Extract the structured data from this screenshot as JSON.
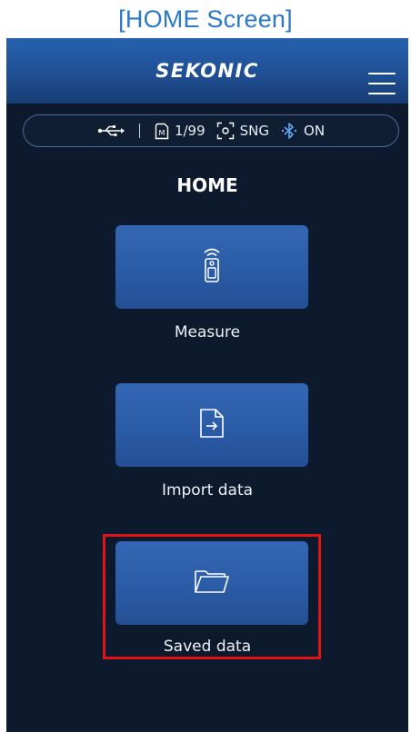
{
  "caption": "[HOME Screen]",
  "header": {
    "brand": "SEKONIC",
    "menu_icon": "hamburger-menu-icon"
  },
  "status_bar": {
    "usb_icon": "usb-icon",
    "memory_icon": "memory-card-icon",
    "memory_count": "1/99",
    "mode_icon": "single-mode-icon",
    "mode": "SNG",
    "bluetooth_icon": "bluetooth-icon",
    "bluetooth_state": "ON"
  },
  "page_title": "HOME",
  "tiles": [
    {
      "label": "Measure",
      "icon": "light-meter-device-icon"
    },
    {
      "label": "Import data",
      "icon": "import-file-icon"
    },
    {
      "label": "Saved data",
      "icon": "folder-icon",
      "highlighted": true
    }
  ],
  "colors": {
    "caption": "#2a79c9",
    "background": "#0d1a2e",
    "header": "#1f4f93",
    "tile": "#2a5aa4",
    "highlight": "#e01414"
  }
}
